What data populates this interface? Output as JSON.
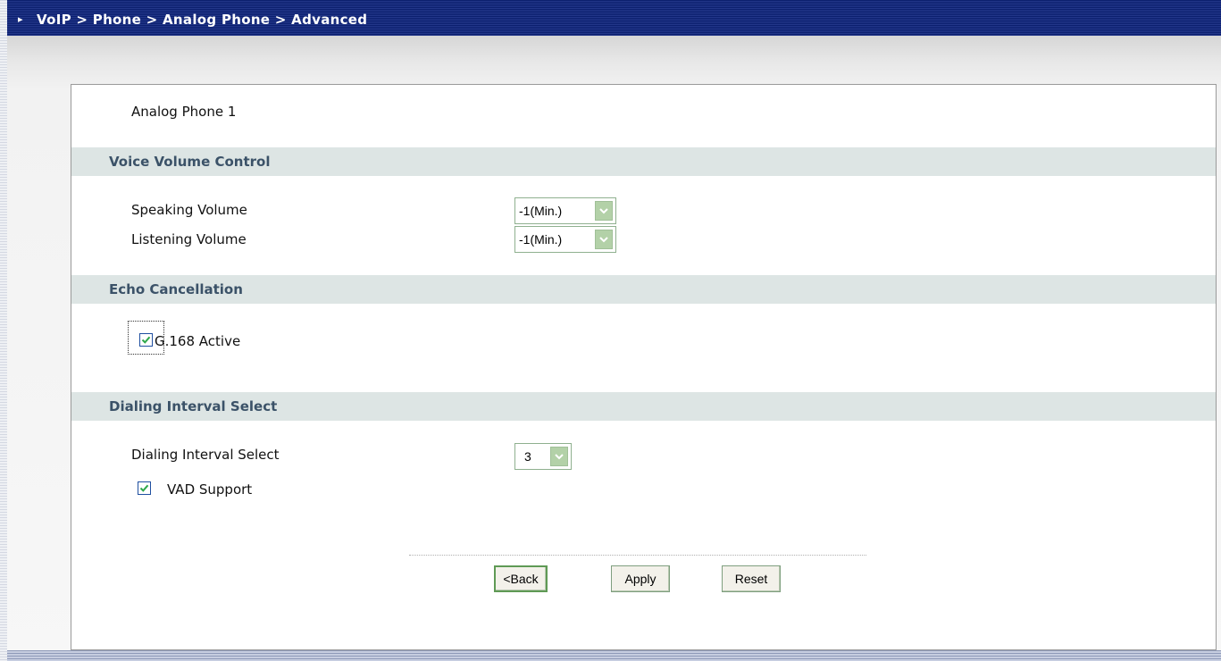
{
  "header": {
    "breadcrumb": "VoIP > Phone > Analog Phone > Advanced"
  },
  "phone": {
    "label": "Analog Phone 1"
  },
  "sections": {
    "voice_volume": {
      "title": "Voice Volume Control",
      "speaking_label": "Speaking Volume",
      "speaking_value": "-1(Min.)",
      "listening_label": "Listening Volume",
      "listening_value": "-1(Min.)"
    },
    "echo": {
      "title": "Echo Cancellation",
      "g168_label": "G.168 Active",
      "g168_checked": true
    },
    "dialing": {
      "title": "Dialing Interval Select",
      "interval_label": "Dialing Interval Select",
      "interval_value": "3",
      "vad_label": "VAD Support",
      "vad_checked": true
    }
  },
  "buttons": {
    "back": "<Back",
    "apply": "Apply",
    "reset": "Reset"
  },
  "colors": {
    "title_bar": "#1c2f85",
    "section_bar": "#dde5e4",
    "section_title": "#3b5268",
    "select_button": "#b3d1a8"
  }
}
